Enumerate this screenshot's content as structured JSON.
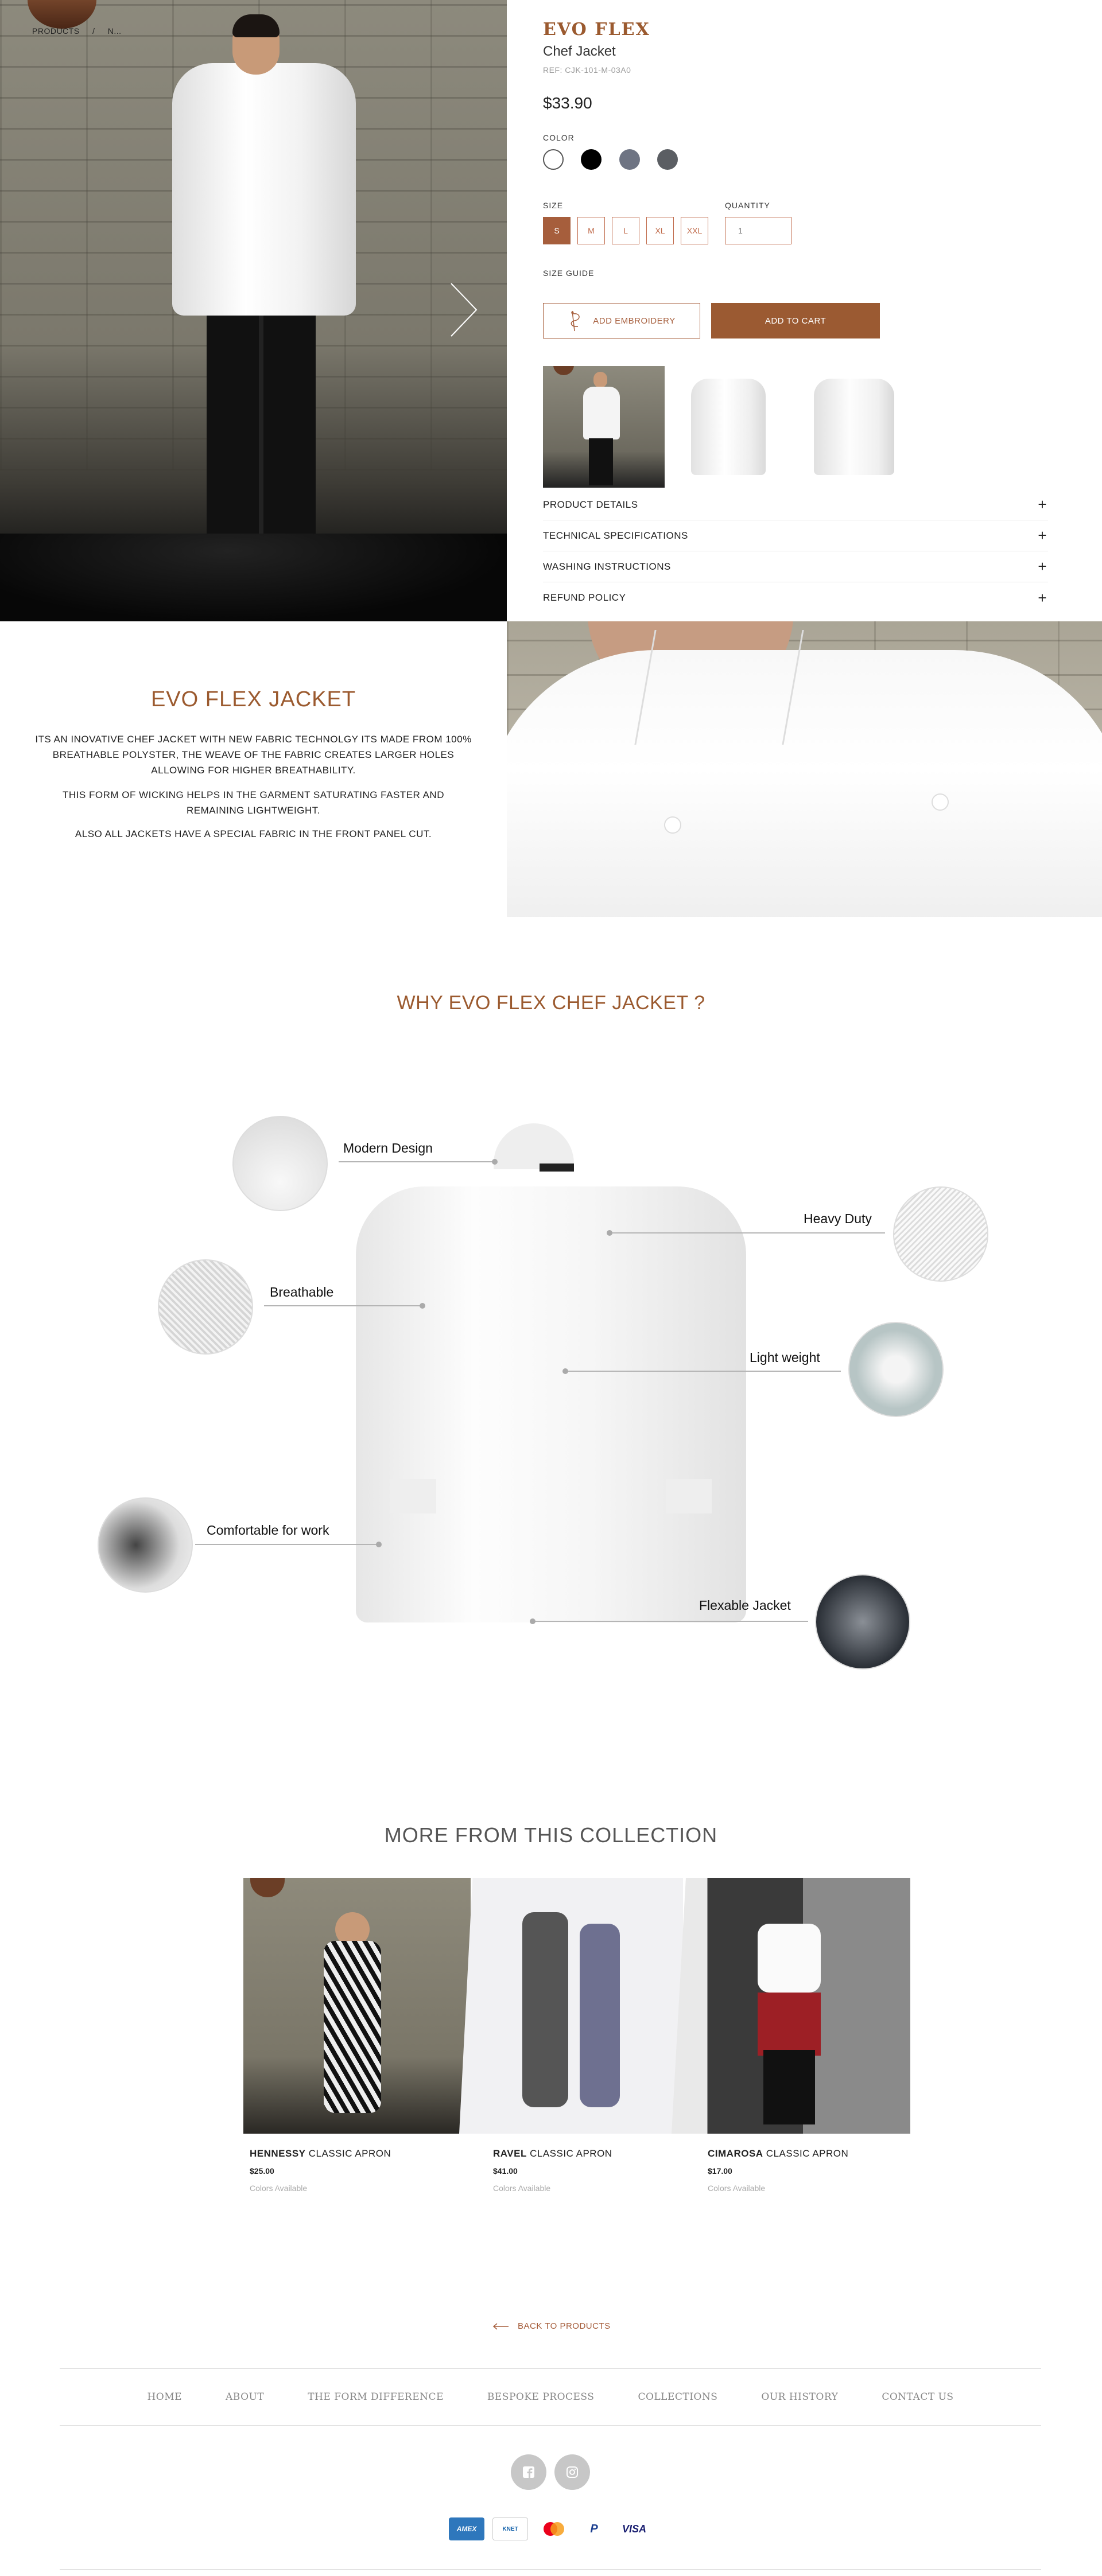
{
  "breadcrumb": {
    "root": "PRODUCTS",
    "separator": "/",
    "current": "N..."
  },
  "product": {
    "brand": "EVO FLEX",
    "name": "Chef Jacket",
    "ref": "REF: CJK-101-M-03A0",
    "price": "$33.90",
    "color_label": "COLOR",
    "colors": [
      {
        "name": "white",
        "hex": "#ffffff",
        "selected": true
      },
      {
        "name": "black",
        "hex": "#000000"
      },
      {
        "name": "gray",
        "hex": "#6e7483"
      },
      {
        "name": "dark gray",
        "hex": "#5b5e63"
      }
    ],
    "size_label": "SIZE",
    "sizes": [
      "S",
      "M",
      "L",
      "XL",
      "XXL"
    ],
    "selected_size": "S",
    "quantity_label": "QUANTITY",
    "quantity": "1",
    "size_guide": "SIZE GUIDE",
    "embroidery_button": "ADD EMBROIDERY",
    "cart_button": "ADD TO CART",
    "accordions": [
      "PRODUCT DETAILS",
      "TECHNICAL SPECIFICATIONS",
      "WASHING INSTRUCTIONS",
      "REFUND POLICY"
    ]
  },
  "story": {
    "title": "EVO FLEX JACKET",
    "p1": "ITS AN INOVATIVE CHEF JACKET WITH NEW FABRIC TECHNOLGY ITS MADE FROM 100% BREATHABLE POLYSTER, THE WEAVE OF THE FABRIC CREATES LARGER HOLES ALLOWING FOR HIGHER BREATHABILITY.",
    "p2": "THIS FORM OF WICKING HELPS IN THE GARMENT SATURATING FASTER AND REMAINING LIGHTWEIGHT.",
    "p3": "ALSO ALL JACKETS HAVE A SPECIAL FABRIC IN THE FRONT PANEL CUT."
  },
  "why": {
    "title": "WHY EVO FLEX CHEF JACKET ?",
    "features": {
      "modern": "Modern Design",
      "breathable": "Breathable",
      "comfortable": "Comfortable for work",
      "heavy": "Heavy Duty",
      "light": "Light weight",
      "flexable": "Flexable Jacket"
    }
  },
  "collection": {
    "title": "MORE FROM THIS COLLECTION",
    "items": [
      {
        "name": "HENNESSY",
        "type": "CLASSIC APRON",
        "price": "$25.00",
        "colors": "Colors Available"
      },
      {
        "name": "RAVEL",
        "type": "CLASSIC APRON",
        "price": "$41.00",
        "colors": "Colors Available"
      },
      {
        "name": "CIMAROSA",
        "type": "CLASSIC APRON",
        "price": "$17.00",
        "colors": "Colors Available"
      }
    ]
  },
  "footer": {
    "back": "BACK TO PRODUCTS",
    "nav": [
      "HOME",
      "ABOUT",
      "THE FORM DIFFERENCE",
      "BESPOKE PROCESS",
      "COLLECTIONS",
      "OUR HISTORY",
      "CONTACT US"
    ],
    "social": [
      "facebook-icon",
      "instagram-icon"
    ],
    "payments": {
      "amex": "AMEX",
      "knet": "KNET",
      "paypal": "P",
      "visa": "VISA"
    }
  },
  "colors": {
    "accent": "#9b5a2f",
    "button": "#9b5a32"
  }
}
